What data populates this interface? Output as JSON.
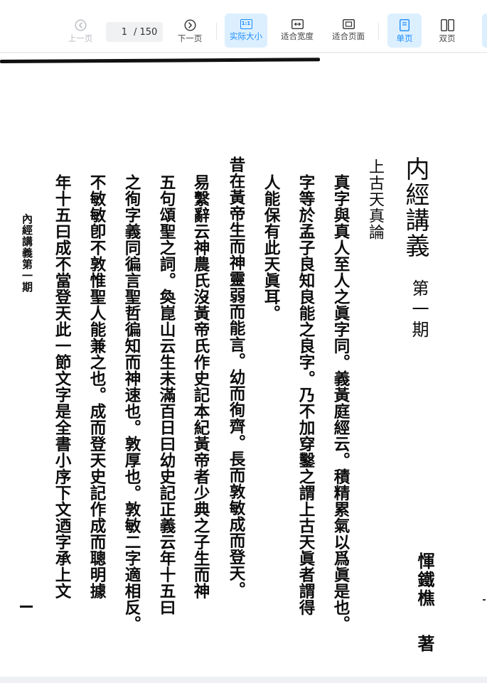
{
  "toolbar": {
    "prev_label": "上一页",
    "next_label": "下一页",
    "current_page": "1",
    "total_pages": "/ 150",
    "actual_size_label": "实际大小",
    "actual_size_badge": "1:1",
    "fit_width_label": "适合宽度",
    "fit_page_label": "适合页面",
    "single_page_label": "单页",
    "double_page_label": "双页",
    "accent_color": "#1a8cff",
    "active_bg": "#dcefff"
  },
  "document": {
    "title": "内經講義",
    "issue": "第一期",
    "subtitle": "上古天真論",
    "author": "惲鐵樵",
    "author_verb": "著",
    "margin_label": "內經講義第一期",
    "page_number_mark": "一",
    "columns": [
      "真字與真人至人之眞字同。義黃庭經云。積精累氣以爲眞是也。",
      "字等於孟子良知良能之良字。乃不加穿鑿之謂上古天眞者謂得",
      "人能保有此天眞耳。",
      "昔在黃帝生而神靈弱而能言。幼而徇齊。長而敦敏成而登天。",
      "易繫辭云神農氏沒黃帝氏作史記本紀黃帝者少典之子生而神",
      "五句頌聖之詞。奐崑山云生未滿百日曰幼史記正義云年十五曰",
      "之徇字義同徧言聖哲徧知而神速也。敦厚也。敦敏二字適相反。",
      "不敏敏卽不敦惟聖人能兼之也。成而登天史記作成而聰明據",
      "年十五曰成不當登天此一節文字是全書小序下文迺字承上文"
    ]
  }
}
